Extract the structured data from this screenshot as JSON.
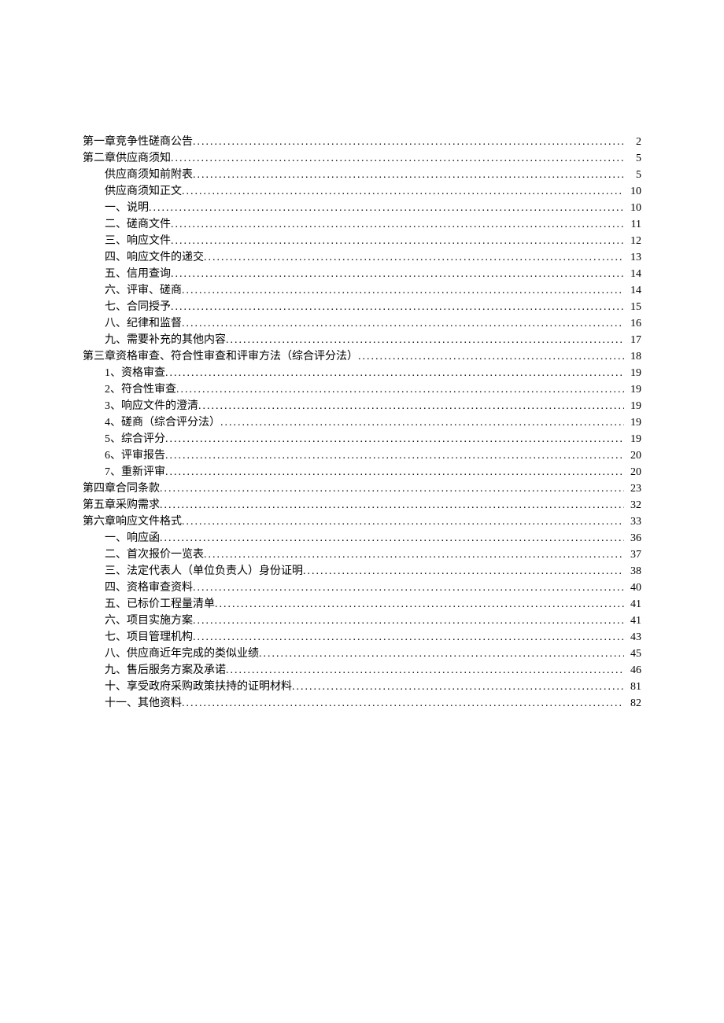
{
  "toc": [
    {
      "label": "第一章竞争性磋商公告",
      "page": "2",
      "indent": 0
    },
    {
      "label": "第二章供应商须知",
      "page": "5",
      "indent": 0
    },
    {
      "label": "供应商须知前附表",
      "page": "5",
      "indent": 1
    },
    {
      "label": "供应商须知正文",
      "page": "10",
      "indent": 1
    },
    {
      "label": "一、说明",
      "page": "10",
      "indent": 1
    },
    {
      "label": "二、磋商文件",
      "page": "11",
      "indent": 1
    },
    {
      "label": "三、响应文件",
      "page": "12",
      "indent": 1
    },
    {
      "label": "四、响应文件的递交",
      "page": "13",
      "indent": 1
    },
    {
      "label": "五、信用查询",
      "page": "14",
      "indent": 1
    },
    {
      "label": "六、评审、磋商",
      "page": "14",
      "indent": 1
    },
    {
      "label": "七、合同授予",
      "page": "15",
      "indent": 1
    },
    {
      "label": "八、纪律和监督",
      "page": "16",
      "indent": 1
    },
    {
      "label": "九、需要补充的其他内容",
      "page": "17",
      "indent": 1
    },
    {
      "label": "第三章资格审查、符合性审查和评审方法（综合评分法）",
      "page": "18",
      "indent": 0
    },
    {
      "label": "1、资格审查",
      "page": "19",
      "indent": 1
    },
    {
      "label": "2、符合性审查",
      "page": "19",
      "indent": 1
    },
    {
      "label": "3、响应文件的澄清",
      "page": "19",
      "indent": 1
    },
    {
      "label": "4、磋商（综合评分法）",
      "page": "19",
      "indent": 1
    },
    {
      "label": "5、综合评分",
      "page": "19",
      "indent": 1
    },
    {
      "label": "6、评审报告",
      "page": "20",
      "indent": 1
    },
    {
      "label": "7、重新评审",
      "page": "20",
      "indent": 1
    },
    {
      "label": "第四章合同条款",
      "page": "23",
      "indent": 0
    },
    {
      "label": "第五章采购需求",
      "page": "32",
      "indent": 0
    },
    {
      "label": "第六章响应文件格式",
      "page": "33",
      "indent": 0
    },
    {
      "label": "一、响应函",
      "page": "36",
      "indent": 1
    },
    {
      "label": "二、首次报价一览表",
      "page": "37",
      "indent": 1
    },
    {
      "label": "三、法定代表人（单位负责人）身份证明",
      "page": "38",
      "indent": 1
    },
    {
      "label": "四、资格审查资料",
      "page": "40",
      "indent": 1
    },
    {
      "label": "五、已标价工程量清单",
      "page": "41",
      "indent": 1
    },
    {
      "label": "六、项目实施方案",
      "page": "41",
      "indent": 1
    },
    {
      "label": "七、项目管理机构",
      "page": "43",
      "indent": 1
    },
    {
      "label": "八、供应商近年完成的类似业绩",
      "page": "45",
      "indent": 1
    },
    {
      "label": "九、售后服务方案及承诺",
      "page": "46",
      "indent": 1
    },
    {
      "label": "十、享受政府采购政策扶持的证明材料",
      "page": "81",
      "indent": 1
    },
    {
      "label": "十一、其他资料",
      "page": "82",
      "indent": 1
    }
  ]
}
